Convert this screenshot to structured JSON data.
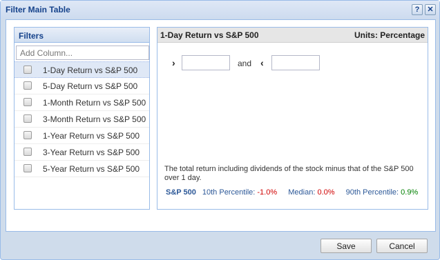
{
  "dialog": {
    "title": "Filter Main Table",
    "help_glyph": "?",
    "close_glyph": "✕"
  },
  "filters": {
    "header": "Filters",
    "add_column_placeholder": "Add Column...",
    "items": [
      {
        "label": "1-Day Return vs S&P 500",
        "checked": false,
        "selected": true
      },
      {
        "label": "5-Day Return vs S&P 500",
        "checked": false,
        "selected": false
      },
      {
        "label": "1-Month Return vs S&P 500",
        "checked": false,
        "selected": false
      },
      {
        "label": "3-Month Return vs S&P 500",
        "checked": false,
        "selected": false
      },
      {
        "label": "1-Year Return vs S&P 500",
        "checked": false,
        "selected": false
      },
      {
        "label": "3-Year Return vs S&P 500",
        "checked": false,
        "selected": false
      },
      {
        "label": "5-Year Return vs S&P 500",
        "checked": false,
        "selected": false
      }
    ]
  },
  "detail": {
    "title": "1-Day Return vs S&P 500",
    "units": "Units: Percentage",
    "gt_glyph": "›",
    "lt_glyph": "‹",
    "and_label": "and",
    "min_value": "",
    "max_value": "",
    "description": "The total return including dividends of the stock minus that of the S&P 500 over 1 day.",
    "stats": {
      "benchmark": "S&P 500",
      "p10_label": "10th Percentile:",
      "p10_value": "-1.0%",
      "median_label": "Median:",
      "median_value": "0.0%",
      "p90_label": "90th Percentile:",
      "p90_value": "0.9%"
    }
  },
  "buttons": {
    "save": "Save",
    "cancel": "Cancel"
  },
  "colors": {
    "title_text": "#15428b",
    "negative": "#d00000",
    "positive": "#008000",
    "link_blue": "#2b5797"
  }
}
